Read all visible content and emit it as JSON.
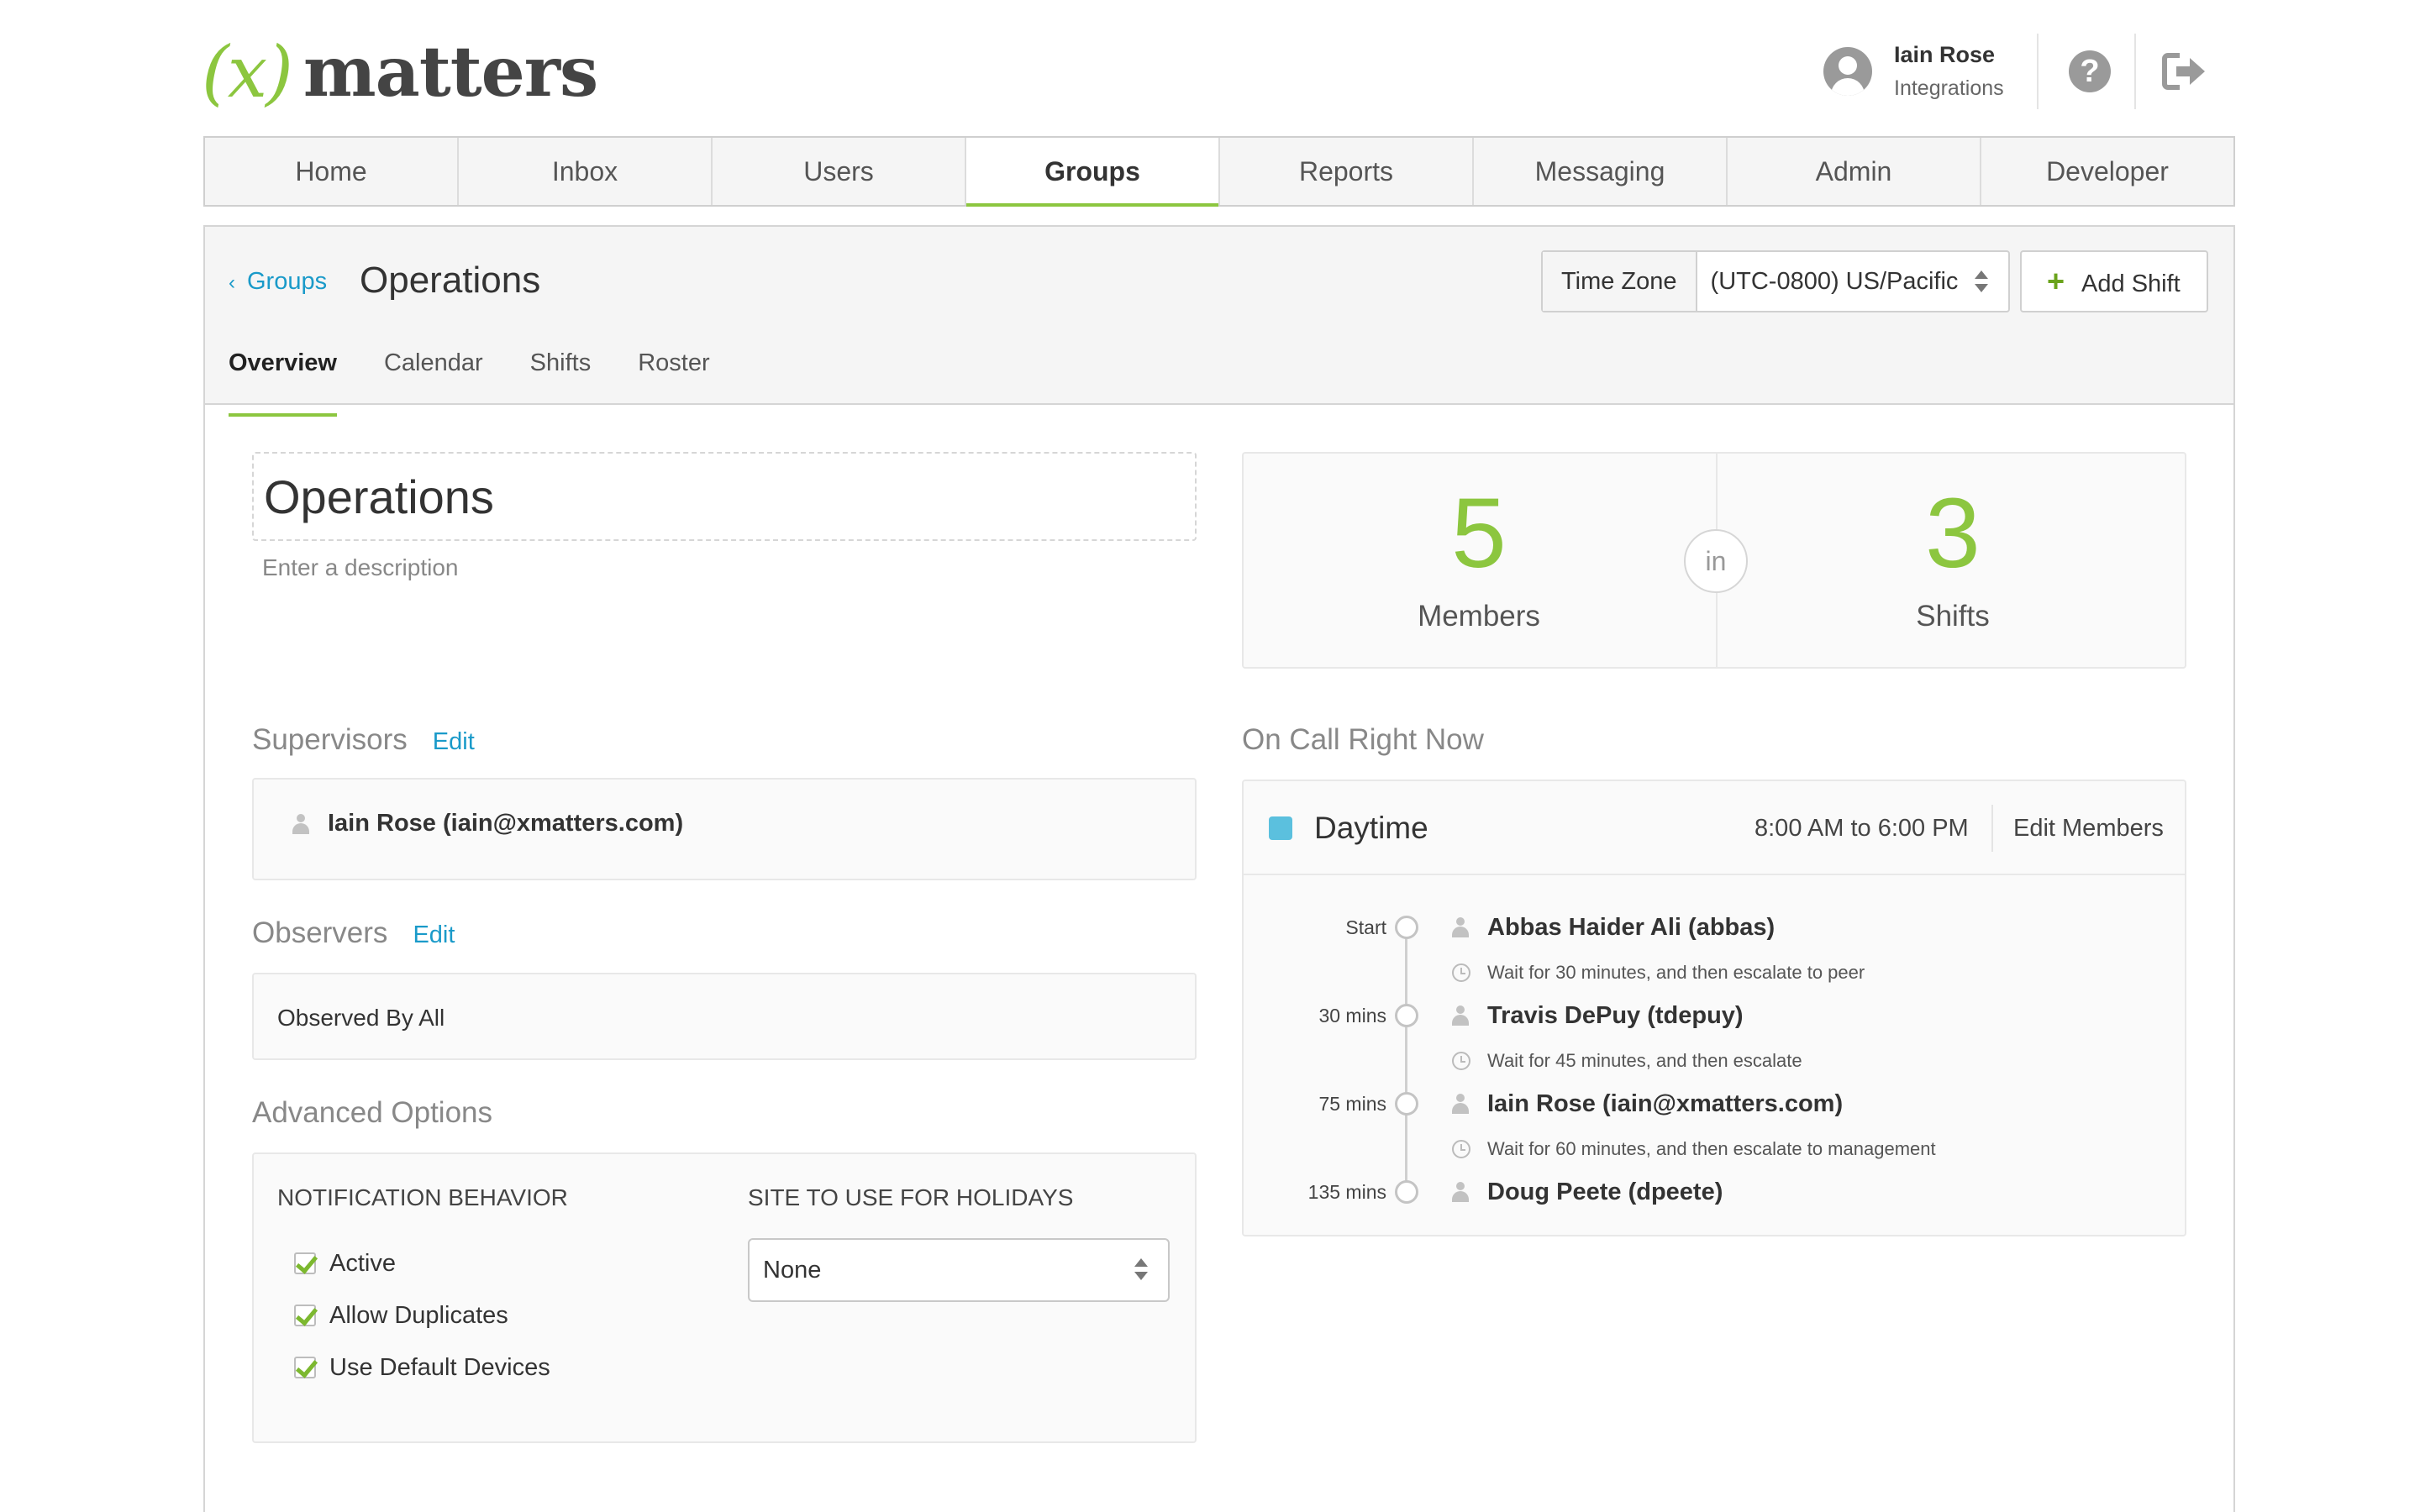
{
  "header": {
    "logo_x": "(x)",
    "logo_word": "matters",
    "user_name": "Iain Rose",
    "user_role": "Integrations",
    "help_icon": "question-circle-icon",
    "logout_icon": "sign-out-icon"
  },
  "nav": {
    "items": [
      {
        "label": "Home"
      },
      {
        "label": "Inbox"
      },
      {
        "label": "Users"
      },
      {
        "label": "Groups"
      },
      {
        "label": "Reports"
      },
      {
        "label": "Messaging"
      },
      {
        "label": "Admin"
      },
      {
        "label": "Developer"
      }
    ],
    "active": "Groups"
  },
  "page": {
    "breadcrumb": "Groups",
    "title": "Operations",
    "time_zone_label": "Time Zone",
    "time_zone_value": "(UTC-0800) US/Pacific",
    "add_shift_label": "Add Shift",
    "tabs": [
      {
        "label": "Overview"
      },
      {
        "label": "Calendar"
      },
      {
        "label": "Shifts"
      },
      {
        "label": "Roster"
      }
    ],
    "active_tab": "Overview"
  },
  "group": {
    "name": "Operations",
    "description_placeholder": "Enter a description"
  },
  "supervisors": {
    "title": "Supervisors",
    "edit_label": "Edit",
    "items": [
      "Iain Rose (iain@xmatters.com)"
    ]
  },
  "observers": {
    "title": "Observers",
    "edit_label": "Edit",
    "value": "Observed By All"
  },
  "advanced": {
    "title": "Advanced Options",
    "notification_header": "NOTIFICATION BEHAVIOR",
    "holiday_header": "SITE TO USE FOR HOLIDAYS",
    "options": [
      {
        "label": "Active",
        "checked": true
      },
      {
        "label": "Allow Duplicates",
        "checked": true
      },
      {
        "label": "Use Default Devices",
        "checked": true
      }
    ],
    "holiday_site": "None"
  },
  "stats": {
    "members_count": "5",
    "members_label": "Members",
    "connector": "in",
    "shifts_count": "3",
    "shifts_label": "Shifts",
    "accent_color": "#8cc63f"
  },
  "on_call": {
    "title": "On Call Right Now",
    "shift_name": "Daytime",
    "shift_color": "#5bc0de",
    "shift_time": "8:00 AM to 6:00 PM",
    "edit_members_label": "Edit Members",
    "escalation": [
      {
        "offset": "Start",
        "person": "Abbas Haider Ali (abbas)",
        "wait": "Wait for 30 minutes, and then escalate to peer"
      },
      {
        "offset": "30 mins",
        "person": "Travis DePuy (tdepuy)",
        "wait": "Wait for 45 minutes, and then escalate"
      },
      {
        "offset": "75 mins",
        "person": "Iain Rose (iain@xmatters.com)",
        "wait": "Wait for 60 minutes, and then escalate to management"
      },
      {
        "offset": "135 mins",
        "person": "Doug Peete (dpeete)",
        "wait": ""
      }
    ]
  }
}
